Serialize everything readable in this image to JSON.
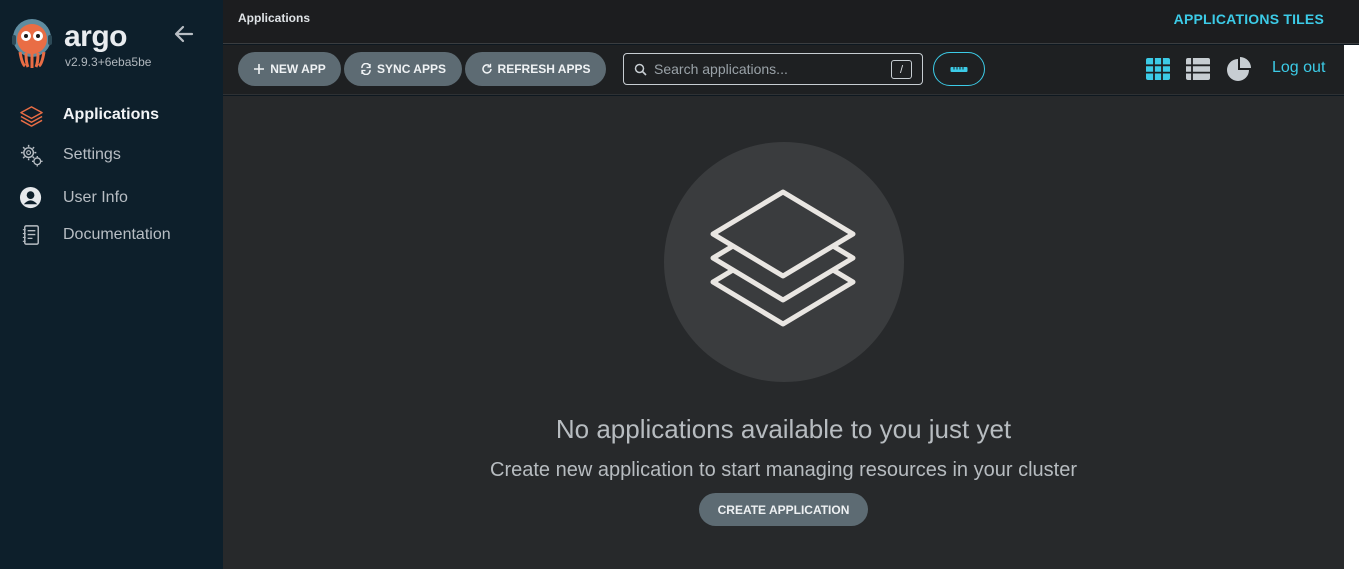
{
  "sidebar": {
    "brand": "argo",
    "version": "v2.9.3+6eba5be",
    "items": [
      {
        "label": "Applications",
        "icon": "layers-icon"
      },
      {
        "label": "Settings",
        "icon": "gears-icon"
      },
      {
        "label": "User Info",
        "icon": "user-circle-icon"
      },
      {
        "label": "Documentation",
        "icon": "book-icon"
      }
    ]
  },
  "header": {
    "breadcrumb": "Applications",
    "title": "APPLICATIONS TILES"
  },
  "toolbar": {
    "new_app": "NEW APP",
    "sync_apps": "SYNC APPS",
    "refresh_apps": "REFRESH APPS",
    "search_placeholder": "Search applications...",
    "search_shortcut": "/",
    "logout": "Log out",
    "views": [
      "tiles-view-icon",
      "list-view-icon",
      "pie-view-icon"
    ]
  },
  "main": {
    "empty_title": "No applications available to you just yet",
    "empty_subtitle": "Create new application to start managing resources in your cluster",
    "create_button": "CREATE APPLICATION"
  },
  "colors": {
    "accent": "#3ccbe7",
    "sidebar_bg": "#0d1f2b",
    "main_bg": "#27292b",
    "button_bg": "#5d6b73",
    "active_icon": "#e96d45"
  }
}
